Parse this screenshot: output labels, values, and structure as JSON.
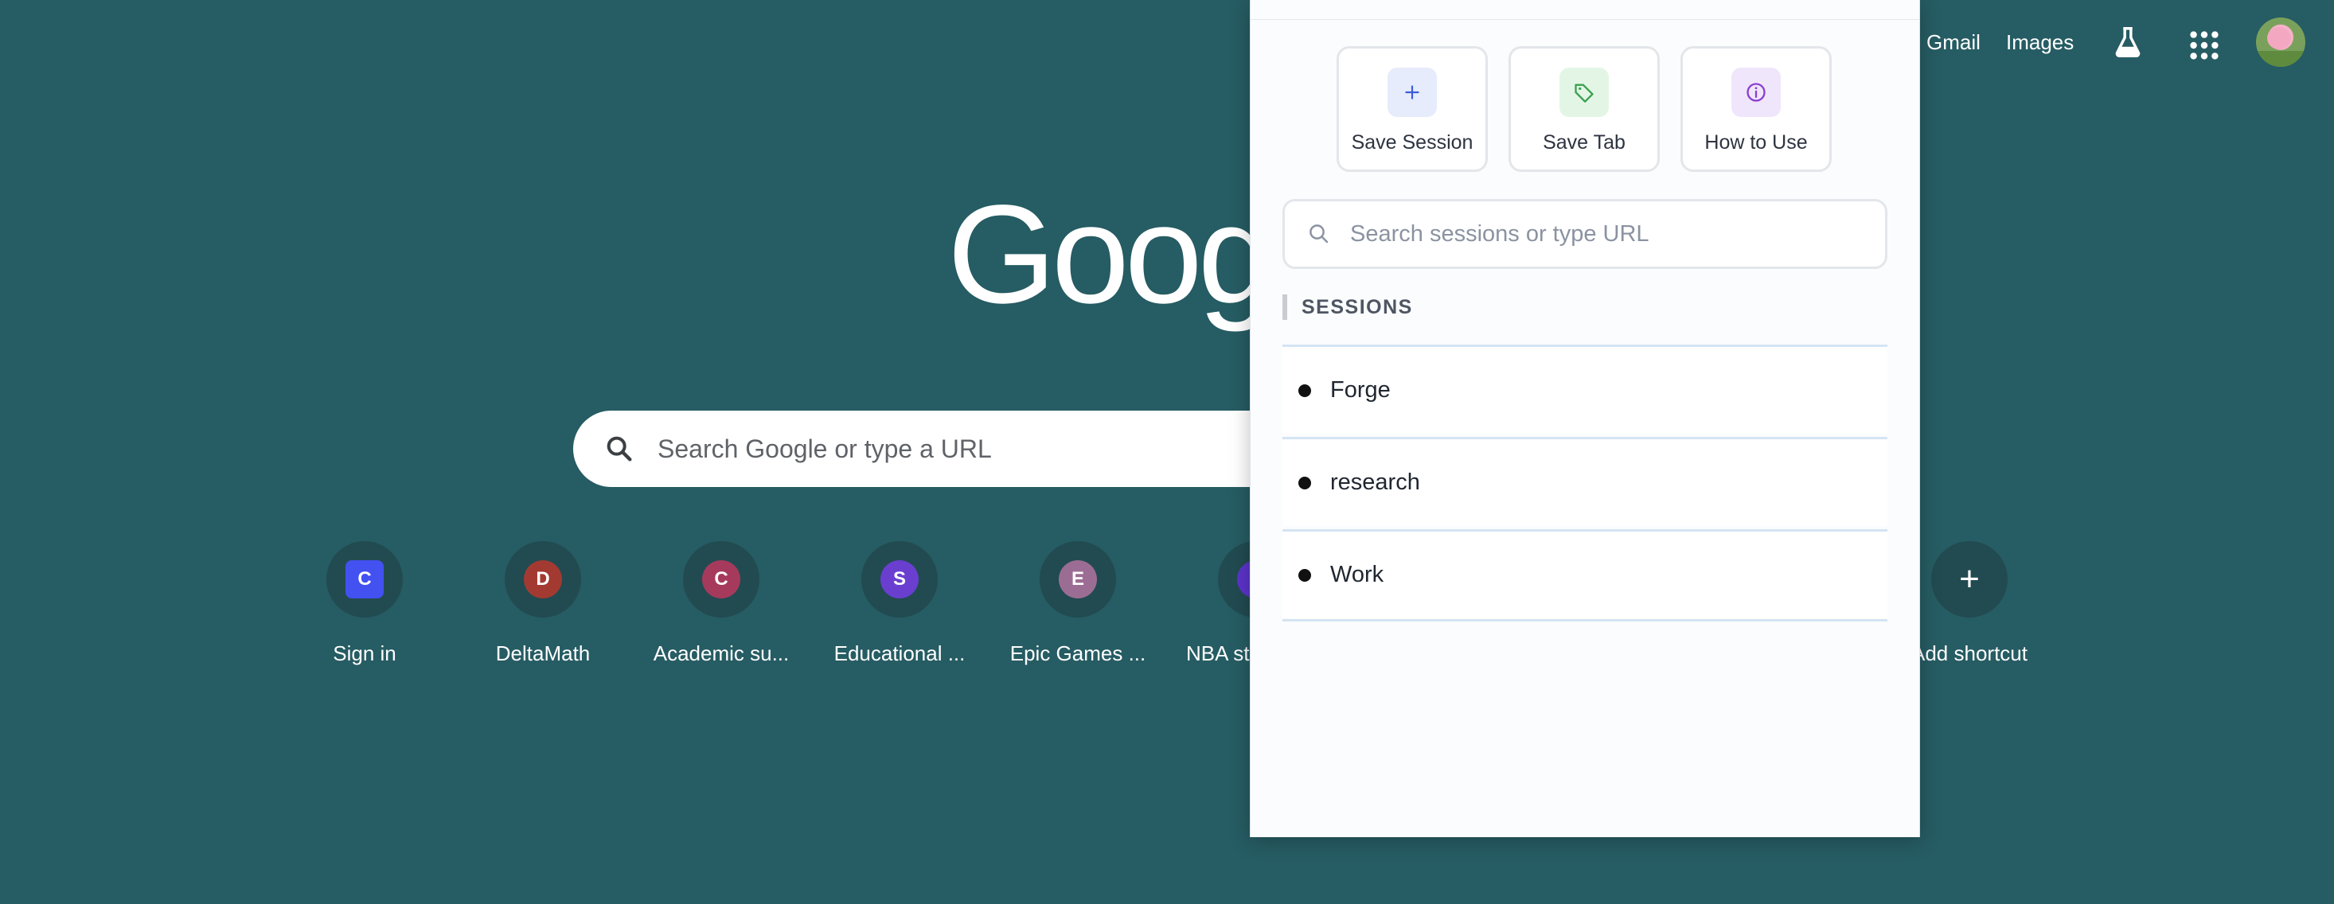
{
  "header": {
    "gmail": "Gmail",
    "images": "Images"
  },
  "logo": {
    "text": "Goog"
  },
  "search": {
    "placeholder": "Search Google or type a URL"
  },
  "shortcuts": [
    {
      "label": "Sign in",
      "letter": "C",
      "color": "#4351f0"
    },
    {
      "label": "DeltaMath",
      "letter": "D",
      "color": "#a33a32"
    },
    {
      "label": "Academic su...",
      "letter": "C",
      "color": "#a63a5c"
    },
    {
      "label": "Educational ...",
      "letter": "S",
      "color": "#6a3fd0"
    },
    {
      "label": "Epic Games ...",
      "letter": "E",
      "color": "#9c6d94"
    },
    {
      "label": "NBA st",
      "letter": "",
      "color": "#5b34c9"
    },
    {
      "label": "Add shortcut",
      "letter": "+",
      "color": "#214b51"
    }
  ],
  "popup": {
    "actions": [
      {
        "label": "Save Session",
        "icon": "plus-icon",
        "bg": "#e6ecfb",
        "color": "#3b5bd6"
      },
      {
        "label": "Save Tab",
        "icon": "tag-icon",
        "bg": "#e3f6e6",
        "color": "#3aa150"
      },
      {
        "label": "How to Use",
        "icon": "info-icon",
        "bg": "#f0e6fb",
        "color": "#8a3fd0"
      }
    ],
    "search_placeholder": "Search sessions or type URL",
    "section_title": "SESSIONS",
    "sessions": [
      {
        "name": "Forge"
      },
      {
        "name": "research"
      },
      {
        "name": "Work"
      }
    ]
  }
}
